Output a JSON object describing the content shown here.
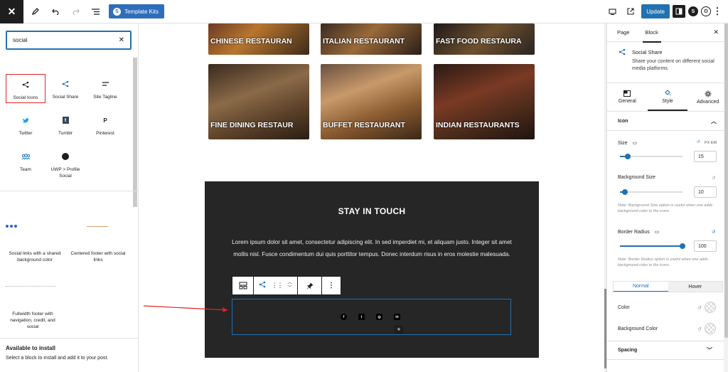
{
  "topbar": {
    "template_kits_label": "Template Kits",
    "update_label": "Update",
    "template_kits_logo": "S"
  },
  "inserter": {
    "search_value": "social",
    "blocks": [
      {
        "label": "Social Icons",
        "icon": "share-icon"
      },
      {
        "label": "Social Share",
        "icon": "share-icon"
      },
      {
        "label": "Site Tagline",
        "icon": "tagline-icon"
      },
      {
        "label": "Twitter",
        "icon": "twitter-icon"
      },
      {
        "label": "Tumblr",
        "icon": "tumblr-icon"
      },
      {
        "label": "Pinterest",
        "icon": "pinterest-icon"
      },
      {
        "label": "Team",
        "icon": "team-icon"
      },
      {
        "label": "UWP > Profile Social",
        "icon": "globe-icon"
      }
    ],
    "patterns": [
      {
        "label": "Social links with a shared background color"
      },
      {
        "label": "Centered footer with social links"
      },
      {
        "label": "Fullwidth footer with navigation, credit, and social"
      }
    ],
    "available_title": "Available to install",
    "available_desc": "Select a block to install and add it to your post."
  },
  "canvas": {
    "top_cards": [
      "CHINESE RESTAURAN",
      "ITALIAN RESTAURANT",
      "FAST FOOD RESTAURA"
    ],
    "cards": [
      "FINE DINING RESTAUR",
      "BUFFET RESTAURANT",
      "INDIAN RESTAURANTS"
    ],
    "section_title": "STAY IN TOUCH",
    "section_body": "Lorem ipsum dolor sit amet, consectetur adipiscing elit. In sed imperdiet mi, et aliquam justo. Integer sit amet mollis nisl. Fusce condimentum dui quis porttitor tempus. Donec interdum risus in eros molestie malesuada.",
    "social_icons": [
      "facebook-icon",
      "twitter-icon",
      "instagram-icon",
      "linkedin-icon"
    ]
  },
  "settings": {
    "tab_page": "Page",
    "tab_block": "Block",
    "block_title": "Social Share",
    "block_desc": "Share your content on different social media platforms.",
    "subtab_general": "General",
    "subtab_style": "Style",
    "subtab_advanced": "Advanced",
    "icon_section": "Icon",
    "size_label": "Size",
    "size_units": "PX EM",
    "size_value": "15",
    "size_fraction": 0.12,
    "bg_size_label": "Background Size",
    "bg_size_value": "10",
    "bg_size_fraction": 0.08,
    "bg_size_note": "Note: Background Size option is useful when one adds background color to the icons.",
    "radius_label": "Border Radius",
    "radius_value": "100",
    "radius_fraction": 1.0,
    "radius_note": "Note: Border Radius option is useful when one adds background color to the icons.",
    "normal_label": "Normal",
    "hover_label": "Hover",
    "color_label": "Color",
    "bg_color_label": "Background Color",
    "spacing_label": "Spacing"
  },
  "colors": {
    "accent": "#2271b1",
    "annotation": "#e02424",
    "dark_section": "#262626"
  }
}
